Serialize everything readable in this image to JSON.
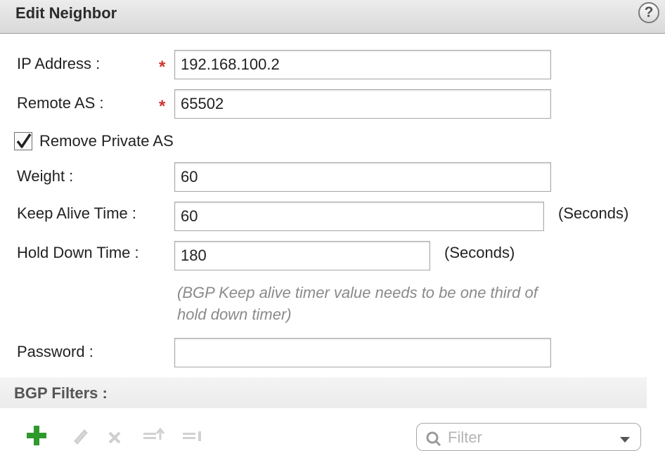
{
  "dialog": {
    "title": "Edit Neighbor",
    "help_symbol": "?"
  },
  "form": {
    "required_marker": "*",
    "ip_address": {
      "label": "IP Address :",
      "value": "192.168.100.2"
    },
    "remote_as": {
      "label": "Remote AS :",
      "value": "65502"
    },
    "remove_private_as": {
      "label": "Remove Private AS",
      "checked": true
    },
    "weight": {
      "label": "Weight :",
      "value": "60"
    },
    "keep_alive_time": {
      "label": "Keep Alive Time :",
      "value": "60",
      "unit": "(Seconds)"
    },
    "hold_down_time": {
      "label": "Hold Down Time :",
      "value": "180",
      "unit": "(Seconds)"
    },
    "timer_hint": "(BGP Keep alive timer value needs to be one third of hold down timer)",
    "password": {
      "label": "Password :",
      "value": ""
    }
  },
  "bgp_filters": {
    "title": "BGP Filters :",
    "toolbar": [
      "add-icon",
      "edit-icon",
      "delete-icon",
      "move-up-icon",
      "move-down-icon"
    ],
    "filter_placeholder": "Filter"
  },
  "colors": {
    "required": "#d0352e",
    "add_icon": "#2e9a2e",
    "hint_text": "#8a8a8a"
  }
}
